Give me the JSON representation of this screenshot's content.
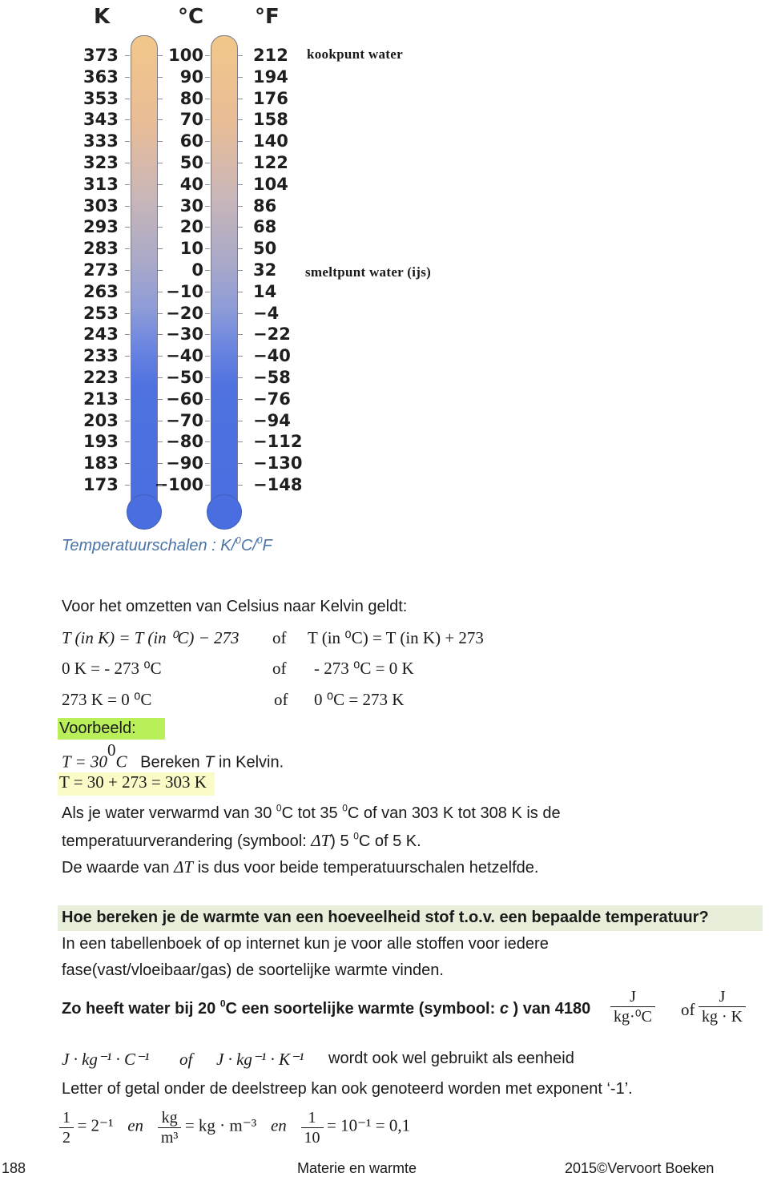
{
  "figure": {
    "headers": {
      "kelvin": "K",
      "celsius": "°C",
      "fahrenheit": "°F"
    },
    "rows": [
      {
        "k": "373",
        "c": "100",
        "f": "212"
      },
      {
        "k": "363",
        "c": "90",
        "f": "194"
      },
      {
        "k": "353",
        "c": "80",
        "f": "176"
      },
      {
        "k": "343",
        "c": "70",
        "f": "158"
      },
      {
        "k": "333",
        "c": "60",
        "f": "140"
      },
      {
        "k": "323",
        "c": "50",
        "f": "122"
      },
      {
        "k": "313",
        "c": "40",
        "f": "104"
      },
      {
        "k": "303",
        "c": "30",
        "f": "86"
      },
      {
        "k": "293",
        "c": "20",
        "f": "68"
      },
      {
        "k": "283",
        "c": "10",
        "f": "50"
      },
      {
        "k": "273",
        "c": "0",
        "f": "32"
      },
      {
        "k": "263",
        "c": "−10",
        "f": "14"
      },
      {
        "k": "253",
        "c": "−20",
        "f": "−4"
      },
      {
        "k": "243",
        "c": "−30",
        "f": "−22"
      },
      {
        "k": "233",
        "c": "−40",
        "f": "−40"
      },
      {
        "k": "223",
        "c": "−50",
        "f": "−58"
      },
      {
        "k": "213",
        "c": "−60",
        "f": "−76"
      },
      {
        "k": "203",
        "c": "−70",
        "f": "−94"
      },
      {
        "k": "193",
        "c": "−80",
        "f": "−112"
      },
      {
        "k": "183",
        "c": "−90",
        "f": "−130"
      },
      {
        "k": "173",
        "c": "−100",
        "f": "−148"
      }
    ],
    "annotation_boiling": "kookpunt water",
    "annotation_melting": "smeltpunt water (ijs)"
  },
  "caption": {
    "prefix": "Temperatuurschalen : K/",
    "sup1": "0",
    "mid": "C/",
    "sup2": "0",
    "suffix": "F"
  },
  "intro": "Voor het omzetten van Celsius naar Kelvin geldt:",
  "formulas": {
    "row1_left": "T (in K) = T (in ⁰C) − 273",
    "row1_of": "of",
    "row1_right": "T (in ⁰C) = T (in K) + 273",
    "row2_left": "0 K = - 273 ⁰C",
    "row2_of": "of",
    "row2_right": "- 273 ⁰C = 0 K",
    "row3_left": "273 K = 0 ⁰C",
    "row3_of": "of",
    "row3_right": "0 ⁰C = 273 K"
  },
  "example": {
    "label": "Voorbeeld:",
    "given_math": "T = 30",
    "given_sup": "0",
    "given_unit": "C",
    "given_text_pre": "Bereken ",
    "given_text_it": "T",
    "given_text_post": " in Kelvin.",
    "solution": "T = 30 + 273 = 303 K"
  },
  "delta": {
    "line1_a": "Als je water verwarmd van 30 ",
    "line1_b": "C tot 35 ",
    "line1_c": "C  of van 303 K tot 308 K is de",
    "line2_a": "temperatuurverandering (symbool: ",
    "line2_sym": "ΔT",
    "line2_b": ") 5  ",
    "line2_c": "C of 5 K.",
    "line3_a": "De waarde van ",
    "line3_sym": "ΔT",
    "line3_b": " is dus voor beide temperatuurschalen hetzelfde.",
    "sup": "0"
  },
  "heading": "Hoe bereken je de warmte van een hoeveelheid stof t.o.v. een bepaalde temperatuur?",
  "body1": "In een tabellenboek  of op internet kun je voor alle stoffen voor iedere",
  "body2": "fase(vast/vloeibaar/gas) de soortelijke warmte vinden.",
  "specific_heat": {
    "text_a": "Zo heeft water bij 20 ",
    "sup": "0",
    "text_b": "C  een soortelijke warmte (symbool: ",
    "symbol": "c",
    "text_c": " ) van 4180",
    "frac1_num": "J",
    "frac1_den": "kg·⁰C",
    "of": "of",
    "frac2_num": "J",
    "frac2_den": "kg · K"
  },
  "units_line": {
    "unit1": "J · kg⁻¹ · C⁻¹",
    "of": "of",
    "unit2": "J · kg⁻¹ · K⁻¹",
    "text": "wordt ook wel gebruikt als eenheid"
  },
  "exponent_note": "Letter of getal onder de deelstreep kan ook genoteerd worden met exponent ‘-1’.",
  "examples_line": {
    "f1_num": "1",
    "f1_den": "2",
    "r1": "= 2⁻¹",
    "en1": "en",
    "f2_num": "kg",
    "f2_den": "m³",
    "r2": "= kg · m⁻³",
    "en2": "en",
    "f3_num": "1",
    "f3_den": "10",
    "r3": "= 10⁻¹ = 0,1"
  },
  "footer": {
    "page": "188",
    "title": "Materie en warmte",
    "copyright": "2015©Vervoort Boeken"
  }
}
